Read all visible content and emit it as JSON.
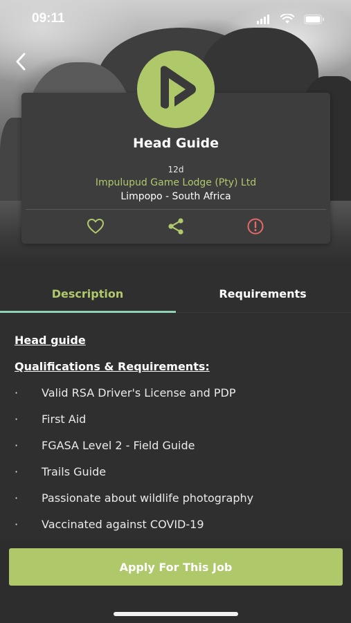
{
  "status_bar": {
    "time": "09:11"
  },
  "colors": {
    "accent": "#afc86a",
    "tab_underline": "#8fd3b5",
    "report": "#e46a6a",
    "background": "#2f2f2f",
    "card": "#3d3d3d"
  },
  "job": {
    "title": "Head Guide",
    "age": "12d",
    "company": "Impulupud Game Lodge (Pty) Ltd",
    "location": "Limpopo - South Africa"
  },
  "actions": {
    "favorite_icon": "heart-icon",
    "share_icon": "share-icon",
    "report_icon": "alert-circle-icon"
  },
  "tabs": [
    {
      "label": "Description",
      "active": true
    },
    {
      "label": "Requirements",
      "active": false
    }
  ],
  "description": {
    "heading": "Head guide",
    "subheading": "Qualifications & Requirements:",
    "bullet": "·",
    "items": [
      "Valid RSA Driver's License and PDP",
      "First Aid",
      "FGASA Level 2 - Field Guide",
      "Trails Guide",
      "Passionate about wildlife photography",
      "Vaccinated against COVID-19"
    ]
  },
  "apply_button": {
    "label": "Apply For This Job"
  }
}
